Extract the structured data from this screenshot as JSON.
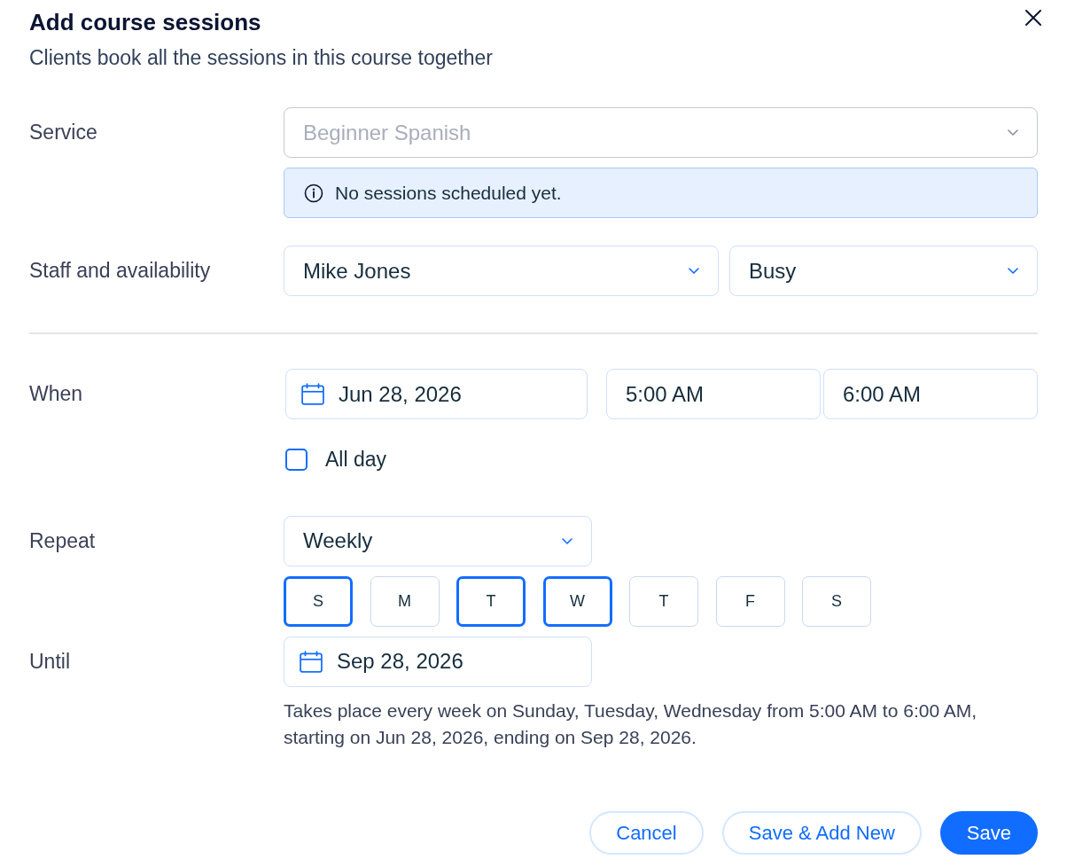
{
  "dialog": {
    "title": "Add course sessions",
    "subtitle": "Clients book all the sessions in this course together"
  },
  "service": {
    "label": "Service",
    "value": "Beginner Spanish",
    "disabled": true,
    "notice": "No sessions scheduled yet."
  },
  "staff": {
    "label": "Staff and availability",
    "staff_member": "Mike Jones",
    "availability": "Busy"
  },
  "when": {
    "label": "When",
    "date": "Jun 28, 2026",
    "start_time": "5:00 AM",
    "end_time": "6:00 AM",
    "all_day": {
      "label": "All day",
      "checked": false
    }
  },
  "repeat": {
    "label": "Repeat",
    "value": "Weekly",
    "days": [
      {
        "label": "S",
        "selected": true
      },
      {
        "label": "M",
        "selected": false
      },
      {
        "label": "T",
        "selected": true
      },
      {
        "label": "W",
        "selected": true
      },
      {
        "label": "T",
        "selected": false
      },
      {
        "label": "F",
        "selected": false
      },
      {
        "label": "S",
        "selected": false
      }
    ]
  },
  "until": {
    "label": "Until",
    "date": "Sep 28, 2026",
    "summary": "Takes place every week on Sunday, Tuesday, Wednesday from 5:00 AM to 6:00 AM, starting on Jun 28, 2026, ending on Sep 28, 2026."
  },
  "buttons": [
    {
      "label": "Cancel",
      "kind": "secondary"
    },
    {
      "label": "Save & Add New",
      "kind": "secondary"
    },
    {
      "label": "Save",
      "kind": "primary"
    }
  ]
}
